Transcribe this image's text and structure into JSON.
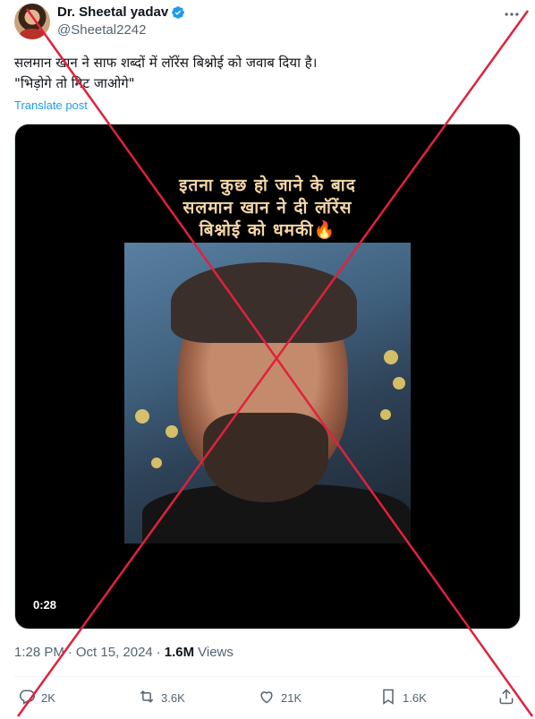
{
  "author": {
    "display_name": "Dr. Sheetal yadav",
    "handle": "@Sheetal2242"
  },
  "tweet": {
    "lines": [
      "सलमान खान ने साफ शब्दों में लॉरेंस बिश्नोई को जवाब दिया है।",
      "\"भिड़ोगे तो मिट जाओगे\""
    ],
    "translate_label": "Translate post"
  },
  "media": {
    "caption_lines": [
      "इतना कुछ हो जाने के बाद",
      "सलमान खान ने दी लॉरेंस",
      "बिश्नोई को धमकी"
    ],
    "caption_emoji": "🔥",
    "duration": "0:28"
  },
  "meta": {
    "time": "1:28 PM",
    "date": "Oct 15, 2024",
    "separator1": "·",
    "separator2": "·",
    "views_count": "1.6M",
    "views_label": "Views"
  },
  "actions": {
    "replies": "2K",
    "reposts": "3.6K",
    "likes": "21K",
    "bookmarks": "1.6K"
  },
  "colors": {
    "accent": "#1d9bf0",
    "cross": "#e0223c"
  },
  "icons": [
    "verified-badge-icon",
    "more-icon",
    "reply-icon",
    "repost-icon",
    "like-icon",
    "bookmark-icon",
    "share-icon",
    "flame-icon"
  ]
}
